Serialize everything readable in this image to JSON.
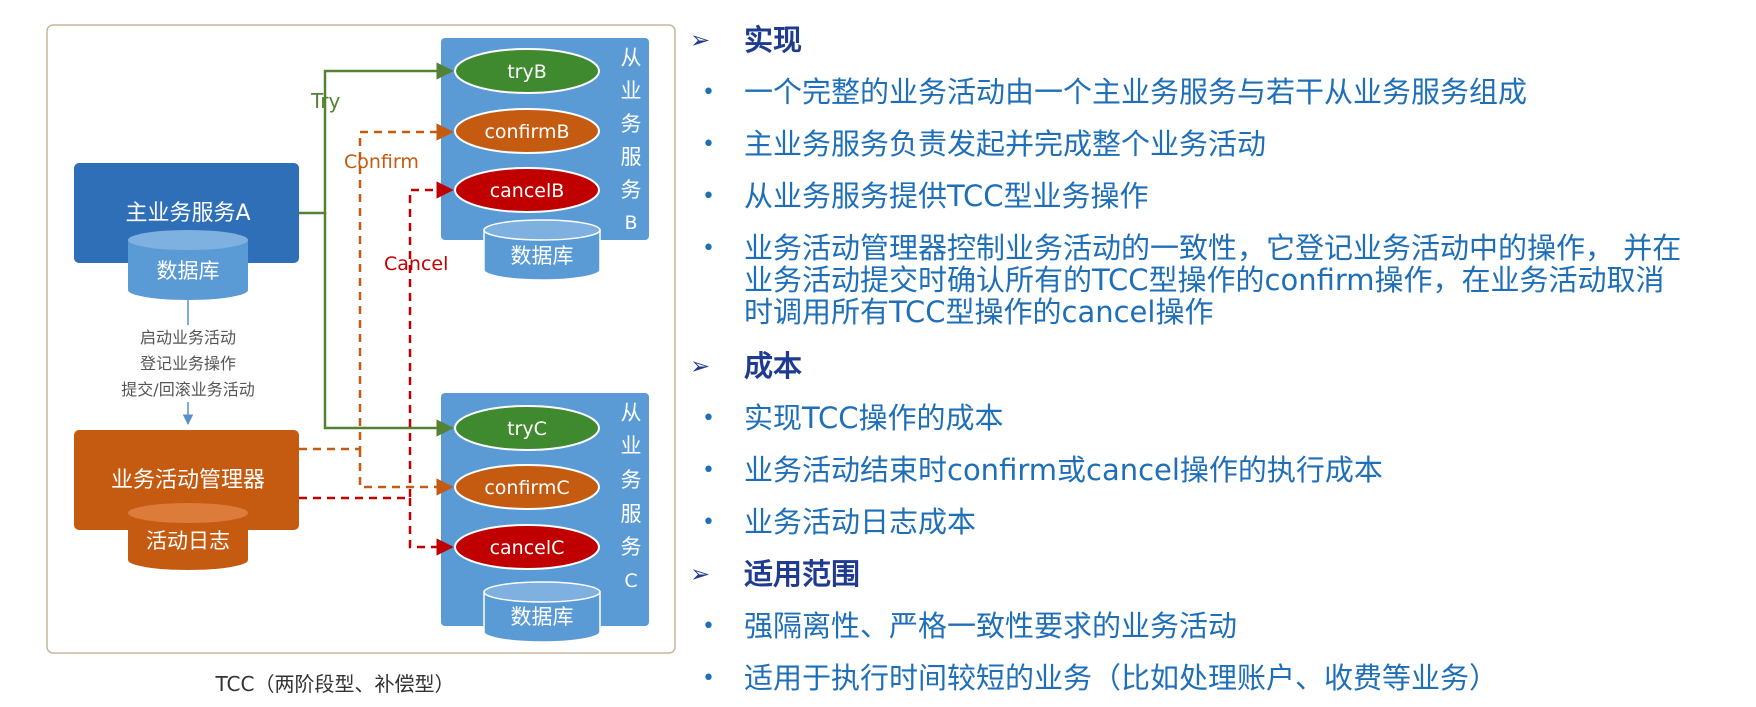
{
  "diagram": {
    "main_service": "主业务服务A",
    "main_db": "数据库",
    "manager": "业务活动管理器",
    "manager_log": "活动日志",
    "notes": [
      "启动业务活动",
      "登记业务操作",
      "提交/回滚业务活动"
    ],
    "try_label": "Try",
    "confirm_label": "Confirm",
    "cancel_label": "Cancel",
    "service_b": {
      "side_label": [
        "从",
        "业",
        "务",
        "服",
        "务",
        "B"
      ],
      "ops": [
        "tryB",
        "confirmB",
        "cancelB"
      ],
      "db": "数据库"
    },
    "service_c": {
      "side_label": [
        "从",
        "业",
        "务",
        "服",
        "务",
        "C"
      ],
      "ops": [
        "tryC",
        "confirmC",
        "cancelC"
      ],
      "db": "数据库"
    },
    "caption": "TCC（两阶段型、补偿型）"
  },
  "sections": [
    {
      "heading": "实现",
      "bullets": [
        "一个完整的业务活动由一个主业务服务与若干从业务服务组成",
        "主业务服务负责发起并完成整个业务活动",
        "从业务服务提供TCC型业务操作",
        [
          "业务活动管理器控制业务活动的一致性，它登记业务活动中的操作， 并在",
          "业务活动提交时确认所有的TCC型操作的confirm操作，在业务活动取消",
          "时调用所有TCC型操作的cancel操作"
        ]
      ]
    },
    {
      "heading": "成本",
      "bullets": [
        "实现TCC操作的成本",
        "业务活动结束时confirm或cancel操作的执行成本",
        "业务活动日志成本"
      ]
    },
    {
      "heading": "适用范围",
      "bullets": [
        "强隔离性、严格一致性要求的业务活动",
        "适用于执行时间较短的业务（比如处理账户、收费等业务）"
      ]
    }
  ],
  "colors": {
    "blue": "#2f6fb7",
    "service_blue": "#5b9bd5",
    "orange": "#c55a11",
    "green": "#548235",
    "green_node": "#3f8a2e",
    "red_node": "#c00000",
    "text_blue": "#1f6fb8",
    "text_dark": "#1f3b8f"
  }
}
